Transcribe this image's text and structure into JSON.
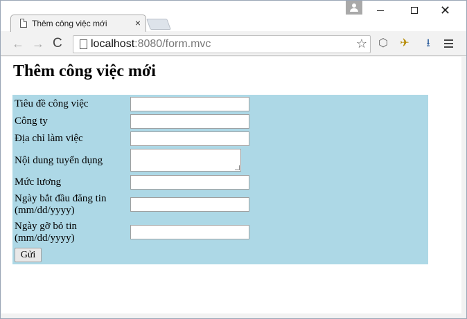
{
  "browser": {
    "tab_title": "Thêm công việc mới",
    "tab_close": "×",
    "url_host": "localhost",
    "url_path": ":8080/form.mvc",
    "back_label": "←",
    "forward_label": "→",
    "reload_label": "C",
    "star_label": "☆",
    "window_close_label": "✕"
  },
  "page": {
    "heading": "Thêm công việc mới",
    "fields": [
      {
        "label": "Tiêu đề công việc",
        "value": ""
      },
      {
        "label": "Công ty",
        "value": ""
      },
      {
        "label": "Địa chỉ làm việc",
        "value": ""
      },
      {
        "label": "Nội dung tuyển dụng",
        "value": ""
      },
      {
        "label": "Mức lương",
        "value": ""
      },
      {
        "label": "Ngày bắt đầu đăng tin (mm/dd/yyyy)",
        "value": ""
      },
      {
        "label": "Ngày gỡ bỏ tin (mm/dd/yyyy)",
        "value": ""
      }
    ],
    "submit_label": "Gửi",
    "panel_color": "#add8e6"
  }
}
